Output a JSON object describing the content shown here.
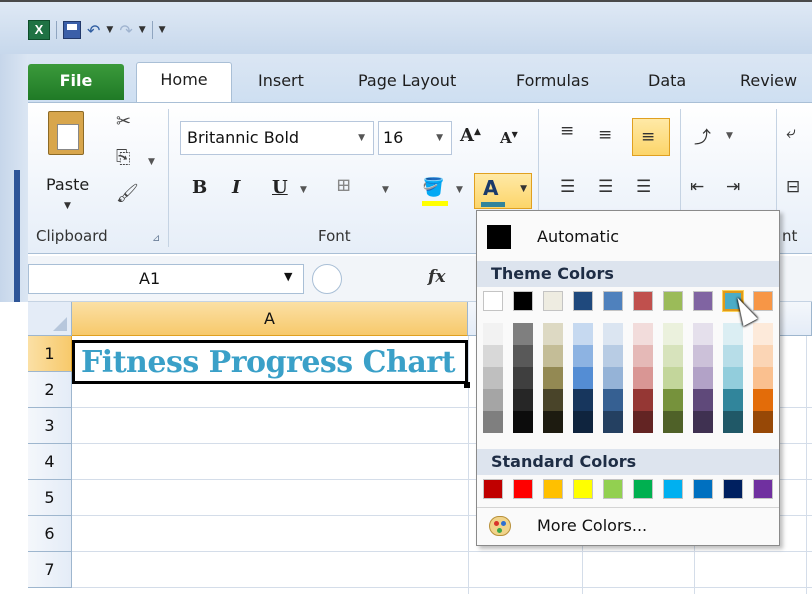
{
  "tabs": [
    {
      "label": "File"
    },
    {
      "label": "Home"
    },
    {
      "label": "Insert"
    },
    {
      "label": "Page Layout"
    },
    {
      "label": "Formulas"
    },
    {
      "label": "Data"
    },
    {
      "label": "Review"
    }
  ],
  "ribbon": {
    "paste_label": "Paste",
    "font_name": "Britannic Bold",
    "font_size": "16",
    "groups": {
      "clipboard": "Clipboard",
      "font": "Font",
      "alignment_partial": "nt"
    },
    "bold": "B",
    "italic": "I",
    "underline": "U"
  },
  "formula_bar": {
    "name_box": "A1",
    "fx_label": "fx"
  },
  "sheet": {
    "columns": [
      "A"
    ],
    "rows": [
      "1",
      "2",
      "3",
      "4",
      "5",
      "6",
      "7"
    ],
    "cell_a1": "Fitness Progress Chart"
  },
  "color_menu": {
    "automatic_label": "Automatic",
    "theme_title": "Theme Colors",
    "standard_title": "Standard Colors",
    "more_colors_label": "More Colors...",
    "theme_top": [
      "#ffffff",
      "#000000",
      "#eeece1",
      "#1f497d",
      "#4f81bd",
      "#c0504d",
      "#9bbb59",
      "#8064a2",
      "#4bacc6",
      "#f79646"
    ],
    "theme_shades": [
      [
        "#f2f2f2",
        "#7f7f7f",
        "#ddd9c3",
        "#c6d9f0",
        "#dbe5f1",
        "#f2dcdb",
        "#ebf1dd",
        "#e5e0ec",
        "#dbeef3",
        "#fdeada"
      ],
      [
        "#d8d8d8",
        "#595959",
        "#c4bd97",
        "#8db3e2",
        "#b8cce4",
        "#e5b9b7",
        "#d7e3bc",
        "#ccc1d9",
        "#b7dde8",
        "#fbd5b5"
      ],
      [
        "#bfbfbf",
        "#3f3f3f",
        "#938953",
        "#548dd4",
        "#95b3d7",
        "#d99694",
        "#c3d69b",
        "#b2a2c7",
        "#92cddc",
        "#fac08f"
      ],
      [
        "#a5a5a5",
        "#262626",
        "#494429",
        "#17365d",
        "#366092",
        "#953734",
        "#76923c",
        "#5f497a",
        "#31859b",
        "#e36c09"
      ],
      [
        "#7f7f7f",
        "#0c0c0c",
        "#1d1b10",
        "#0f243e",
        "#244061",
        "#632423",
        "#4f6128",
        "#3f3151",
        "#205867",
        "#974806"
      ]
    ],
    "standard": [
      "#c00000",
      "#ff0000",
      "#ffc000",
      "#ffff00",
      "#92d050",
      "#00b050",
      "#00b0f0",
      "#0070c0",
      "#002060",
      "#7030a0"
    ],
    "hovered_theme_index": 8
  }
}
